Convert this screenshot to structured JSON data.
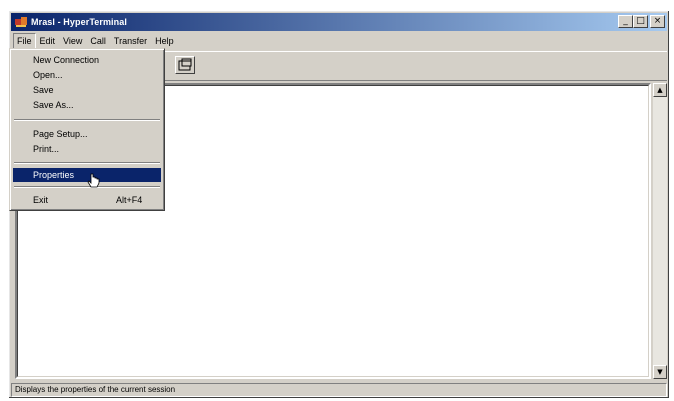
{
  "window": {
    "title": "Mrasl - HyperTerminal"
  },
  "title_controls": {
    "minimize": "_",
    "maximize": "□",
    "close": "×"
  },
  "menubar": {
    "items": [
      "File",
      "Edit",
      "View",
      "Call",
      "Transfer",
      "Help"
    ],
    "active": "File"
  },
  "file_menu": {
    "items": [
      {
        "label": "New Connection",
        "shortcut": ""
      },
      {
        "label": "Open...",
        "shortcut": ""
      },
      {
        "label": "Save",
        "shortcut": ""
      },
      {
        "label": "Save As...",
        "shortcut": ""
      },
      {
        "label": "Page Setup...",
        "shortcut": ""
      },
      {
        "label": "Print...",
        "shortcut": ""
      },
      {
        "label": "Properties",
        "shortcut": ""
      },
      {
        "label": "Exit",
        "shortcut": "Alt+F4"
      }
    ],
    "highlighted": "Properties"
  },
  "scrollbar": {
    "up": "▲",
    "down": "▼"
  },
  "statusbar": {
    "text": "Displays the properties of the current session"
  },
  "colors": {
    "title_active": "#0a246a",
    "highlight": "#0a246a",
    "face": "#d4d0c8"
  }
}
